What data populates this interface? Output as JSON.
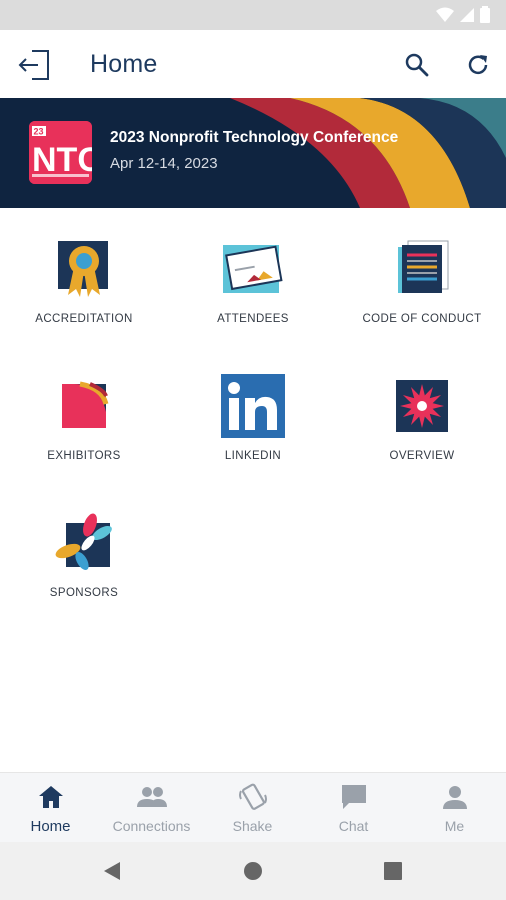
{
  "app_bar": {
    "title": "Home"
  },
  "banner": {
    "title": "2023 Nonprofit Technology Conference",
    "dates": "Apr 12-14, 2023",
    "logo_text": "NTC",
    "logo_year": "23"
  },
  "grid": {
    "items": [
      {
        "label": "ACCREDITATION",
        "icon": "ribbon-award-icon"
      },
      {
        "label": "ATTENDEES",
        "icon": "name-card-icon"
      },
      {
        "label": "CODE OF CONDUCT",
        "icon": "document-icon"
      },
      {
        "label": "EXHIBITORS",
        "icon": "color-arcs-icon"
      },
      {
        "label": "LINKEDIN",
        "icon": "linkedin-icon"
      },
      {
        "label": "OVERVIEW",
        "icon": "starburst-icon"
      },
      {
        "label": "SPONSORS",
        "icon": "petals-icon"
      }
    ]
  },
  "bottom_nav": {
    "items": [
      {
        "label": "Home",
        "icon": "home-icon",
        "active": true
      },
      {
        "label": "Connections",
        "icon": "people-icon",
        "active": false
      },
      {
        "label": "Shake",
        "icon": "shake-phone-icon",
        "active": false
      },
      {
        "label": "Chat",
        "icon": "chat-bubble-icon",
        "active": false
      },
      {
        "label": "Me",
        "icon": "person-icon",
        "active": false
      }
    ]
  },
  "colors": {
    "primary": "#1e3a5f",
    "banner_bg": "#0f2440",
    "logo_pink": "#e8315a",
    "inactive": "#9aa1aa"
  }
}
